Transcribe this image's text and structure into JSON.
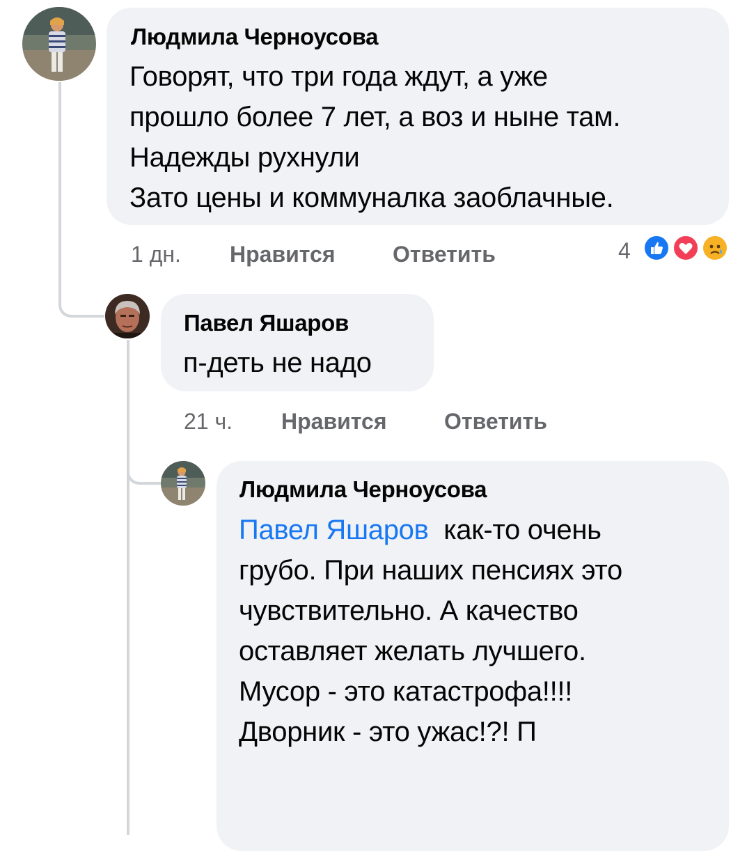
{
  "comments": [
    {
      "author": "Людмила Черноусова",
      "lines": [
        "Говорят, что три года ждут, а уже",
        "прошло более 7 лет, а воз и ныне там.",
        "Надежды рухнули",
        "Зато цены и коммуналка заоблачные."
      ],
      "time": "1 дн.",
      "like_label": "Нравится",
      "reply_label": "Ответить",
      "reaction_count": "4",
      "reactions": [
        "like-icon",
        "love-icon",
        "sad-icon"
      ]
    },
    {
      "author": "Павел Яшаров",
      "lines": [
        "п-деть не надо"
      ],
      "time": "21 ч.",
      "like_label": "Нравится",
      "reply_label": "Ответить"
    },
    {
      "author": "Людмила Черноусова",
      "mention": "Павел Яшаров",
      "first_line_rest": "как-то очень",
      "lines": [
        "грубо. При наших пенсиях это",
        "чувствительно. А качество",
        "оставляет желать лучшего.",
        "Мусор - это катастрофа!!!!",
        "Дворник - это ужас!?! П"
      ]
    }
  ],
  "colors": {
    "bubble": "#f0f2f5",
    "mention": "#1877f2",
    "meta": "#65676b",
    "like": "#1877f2",
    "love": "#f33e58",
    "sad": "#f7b125"
  }
}
